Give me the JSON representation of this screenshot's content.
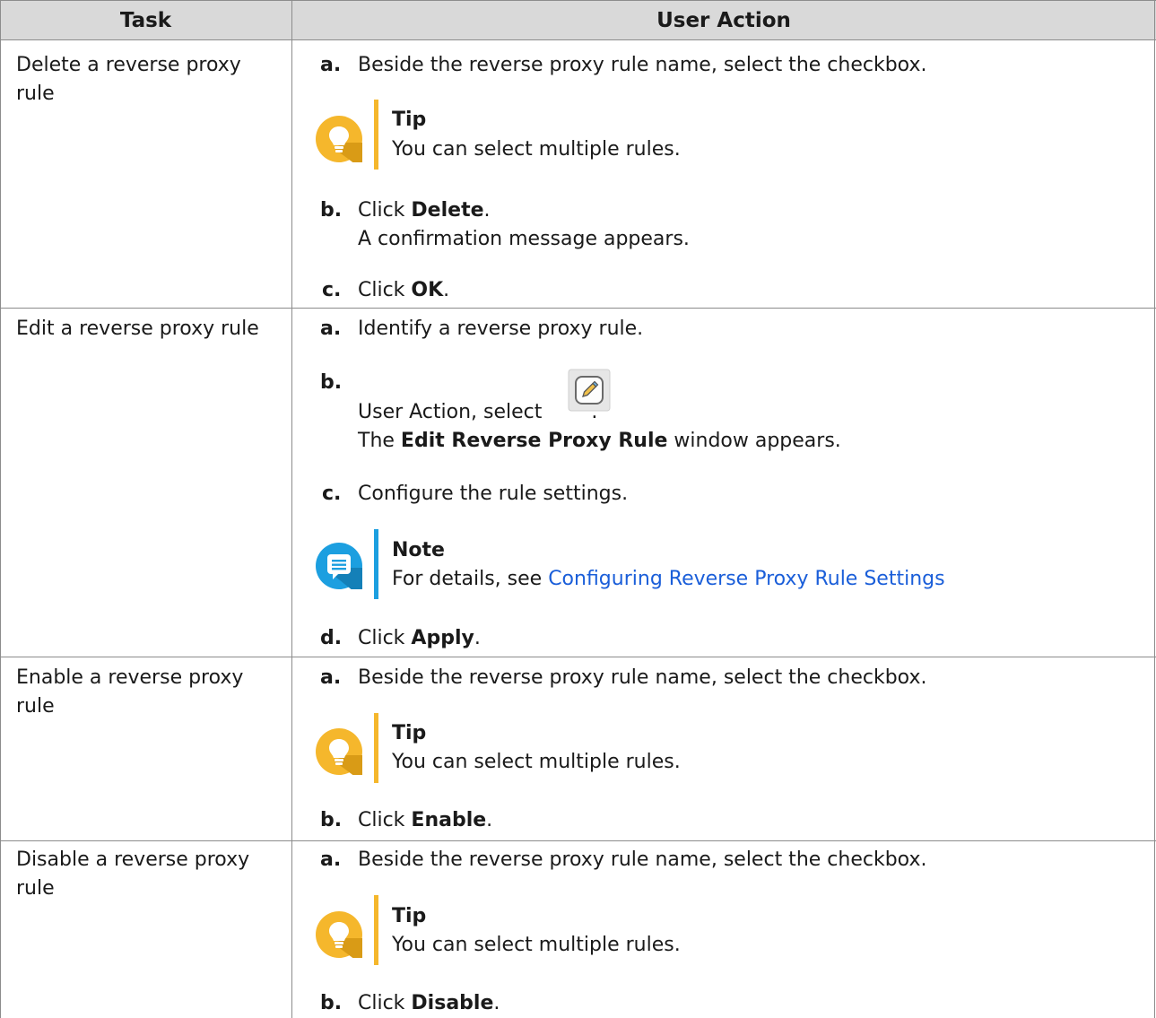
{
  "table": {
    "headers": {
      "task": "Task",
      "action": "User Action"
    },
    "colors": {
      "tip_accent": "#f5b72c",
      "note_accent": "#1c9fe0",
      "link": "#1a5ed9"
    },
    "rows": [
      {
        "task": "Delete a reverse proxy rule",
        "steps": [
          {
            "letter": "a.",
            "text": "Beside the reverse proxy rule name, select the checkbox."
          },
          {
            "callout": {
              "type": "tip",
              "icon": "lightbulb-icon",
              "title": "Tip",
              "text": "You can select multiple rules."
            }
          },
          {
            "letter": "b.",
            "pre": "Click ",
            "bold": "Delete",
            "post": ".",
            "line2": "A confirmation message appears."
          },
          {
            "letter": "c.",
            "pre": "Click ",
            "bold": "OK",
            "post": "."
          }
        ]
      },
      {
        "task": "Edit a reverse proxy rule",
        "steps": [
          {
            "letter": "a.",
            "text": "Identify a reverse proxy rule."
          },
          {
            "letter": "b.",
            "pre": "User Action, select ",
            "icon": "edit-pencil-icon",
            "post": ".",
            "line2_pre": "The ",
            "line2_bold": "Edit Reverse Proxy Rule",
            "line2_post": " window appears."
          },
          {
            "letter": "c.",
            "text": "Configure the rule settings."
          },
          {
            "callout": {
              "type": "note",
              "icon": "note-chat-icon",
              "title": "Note",
              "text_pre": "For details, see ",
              "link": "Configuring Reverse Proxy Rule Settings"
            }
          },
          {
            "letter": "d.",
            "pre": "Click ",
            "bold": "Apply",
            "post": "."
          }
        ]
      },
      {
        "task": "Enable a reverse proxy rule",
        "steps": [
          {
            "letter": "a.",
            "text": "Beside the reverse proxy rule name, select the checkbox."
          },
          {
            "callout": {
              "type": "tip",
              "icon": "lightbulb-icon",
              "title": "Tip",
              "text": "You can select multiple rules."
            }
          },
          {
            "letter": "b.",
            "pre": "Click ",
            "bold": "Enable",
            "post": "."
          }
        ]
      },
      {
        "task": "Disable a reverse proxy rule",
        "steps": [
          {
            "letter": "a.",
            "text": "Beside the reverse proxy rule name, select the checkbox."
          },
          {
            "callout": {
              "type": "tip",
              "icon": "lightbulb-icon",
              "title": "Tip",
              "text": "You can select multiple rules."
            }
          },
          {
            "letter": "b.",
            "pre": "Click ",
            "bold": "Disable",
            "post": "."
          }
        ]
      }
    ]
  }
}
